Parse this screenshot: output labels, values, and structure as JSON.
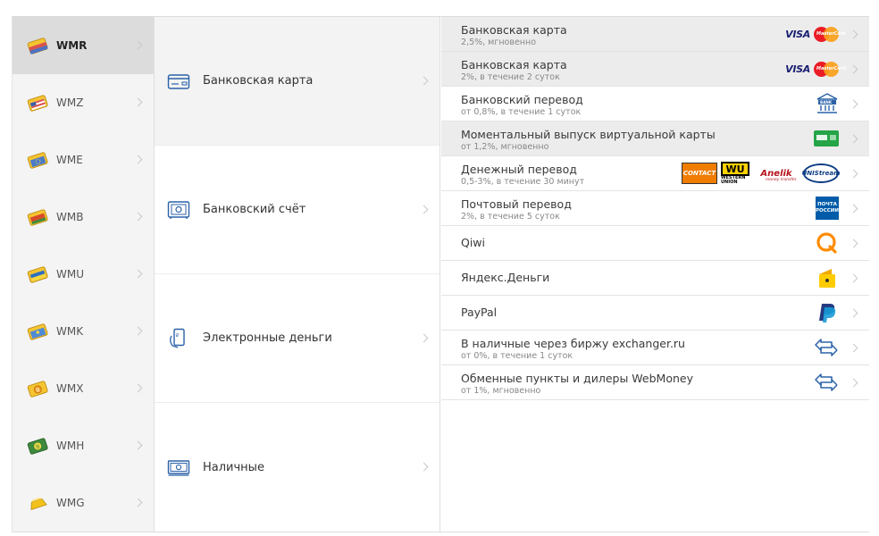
{
  "currencies": [
    {
      "code": "WMR",
      "color": "#d9534f"
    },
    {
      "code": "WMZ",
      "color": "#4a9a4a"
    },
    {
      "code": "WME",
      "color": "#4a7ac8"
    },
    {
      "code": "WMB",
      "color": "#e86a3a"
    },
    {
      "code": "WMU",
      "color": "#2c6fc0"
    },
    {
      "code": "WMK",
      "color": "#4f8ad6"
    },
    {
      "code": "WMX",
      "color": "#f2b51c"
    },
    {
      "code": "WMH",
      "color": "#3d8a3d"
    },
    {
      "code": "WMG",
      "color": "#e8b31c"
    }
  ],
  "active_currency": "WMR",
  "methods": [
    {
      "label": "Банковская карта",
      "icon": "bank-card-icon"
    },
    {
      "label": "Банковский счёт",
      "icon": "safe-icon"
    },
    {
      "label": "Электронные деньги",
      "icon": "phone-payment-icon"
    },
    {
      "label": "Наличные",
      "icon": "cash-icon"
    }
  ],
  "active_method": "Банковская карта",
  "options": [
    {
      "title": "Банковская карта",
      "sub": "2,5%, мгновенно"
    },
    {
      "title": "Банковская карта",
      "sub": "2%, в течение 2 суток"
    },
    {
      "title": "Банковский перевод",
      "sub": "от 0,8%, в течение 1 суток"
    },
    {
      "title": "Моментальный выпуск виртуальной карты",
      "sub": "от 1,2%, мгновенно"
    },
    {
      "title": "Денежный перевод",
      "sub": "0,5-3%, в течение 30 минут"
    },
    {
      "title": "Почтовый перевод",
      "sub": "2%, в течение 5 суток"
    },
    {
      "title": "Qiwi",
      "sub": ""
    },
    {
      "title": "Яндекс.Деньги",
      "sub": ""
    },
    {
      "title": "PayPal",
      "sub": ""
    },
    {
      "title": "В наличные через биржу exchanger.ru",
      "sub": "от 0%, в течение 1 суток"
    },
    {
      "title": "Обменные пункты и дилеры WebMoney",
      "sub": "от 1%, мгновенно"
    }
  ],
  "logos": {
    "visa": "VISA",
    "mastercard": "MasterCard",
    "bank": "BANK",
    "contact": "CONTACT",
    "wu_mark": "WU",
    "wu_text": "WESTERN UNION",
    "anelik": "Anelik",
    "anelik_sub": "money transfer",
    "unistream": "UNIStream",
    "pochta": "ПОЧТА РОССИИ"
  },
  "accent": "#2a62a8"
}
